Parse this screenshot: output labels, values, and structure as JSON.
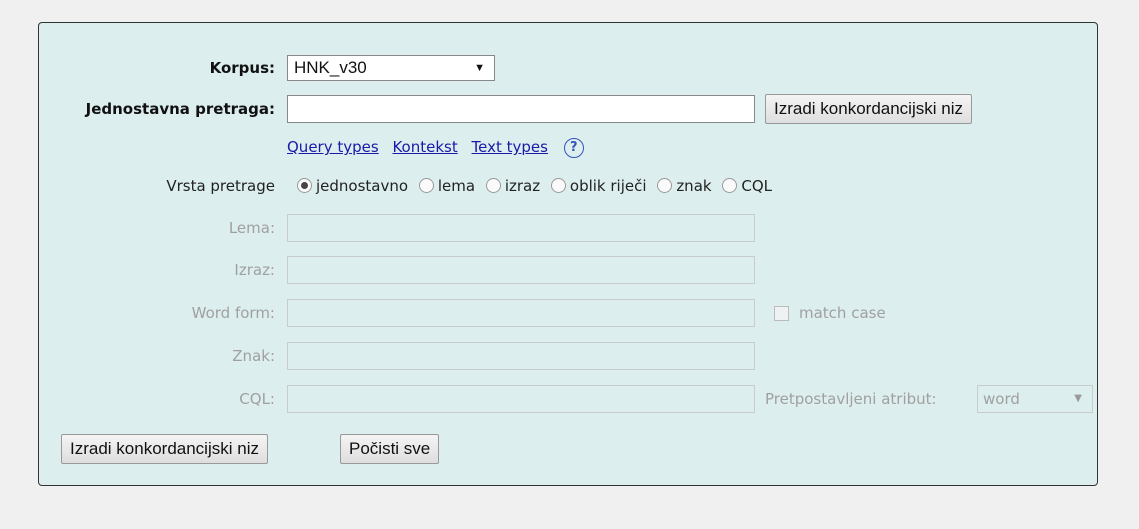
{
  "form": {
    "korpus": {
      "label": "Korpus:",
      "value": "HNK_v30"
    },
    "simple_search": {
      "label": "Jednostavna pretraga:",
      "value": "",
      "button": "Izradi konkordancijski niz"
    },
    "links": [
      "Query types",
      "Kontekst",
      "Text types"
    ],
    "help_icon": "?",
    "query_type": {
      "label": "Vrsta pretrage",
      "options": [
        "jednostavno",
        "lema",
        "izraz",
        "oblik riječi",
        "znak",
        "CQL"
      ],
      "selected": "jednostavno"
    },
    "lema": {
      "label": "Lema:"
    },
    "izraz": {
      "label": "Izraz:"
    },
    "word_form": {
      "label": "Word form:",
      "match_case": "match case"
    },
    "znak": {
      "label": "Znak:"
    },
    "cql": {
      "label": "CQL:",
      "default_attr_label": "Pretpostavljeni atribut:",
      "default_attr_value": "word"
    },
    "buttons": {
      "submit": "Izradi konkordancijski niz",
      "clear": "Počisti sve"
    }
  },
  "colors": {
    "panel_bg": "#ddeeee",
    "link": "#1a1aa6",
    "disabled_text": "#a0a0a0"
  }
}
